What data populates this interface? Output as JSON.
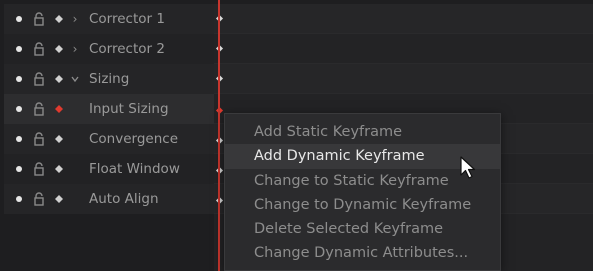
{
  "tracks": [
    {
      "label": "Corrector 1",
      "expander": "chevron-right",
      "keyframe_color": "#d0d0d0"
    },
    {
      "label": "Corrector 2",
      "expander": "chevron-right",
      "keyframe_color": "#d0d0d0"
    },
    {
      "label": "Sizing",
      "expander": "chevron-down",
      "keyframe_color": "#d0d0d0"
    },
    {
      "label": "Input Sizing",
      "expander": "",
      "keyframe_color": "#e03a2f"
    },
    {
      "label": "Convergence",
      "expander": "",
      "keyframe_color": "#d0d0d0"
    },
    {
      "label": "Float Window",
      "expander": "",
      "keyframe_color": "#d0d0d0"
    },
    {
      "label": "Auto Align",
      "expander": "",
      "keyframe_color": "#d0d0d0"
    }
  ],
  "context_menu": {
    "items": [
      {
        "label": "Add Static Keyframe"
      },
      {
        "label": "Add Dynamic Keyframe"
      },
      {
        "label": "Change to Static Keyframe"
      },
      {
        "label": "Change to Dynamic Keyframe"
      },
      {
        "label": "Delete Selected Keyframe"
      },
      {
        "label": "Change Dynamic Attributes..."
      }
    ]
  },
  "colors": {
    "playhead": "#c8362e",
    "active_keyframe": "#e03a2f",
    "menu_hover_text": "#e8e8e8"
  }
}
